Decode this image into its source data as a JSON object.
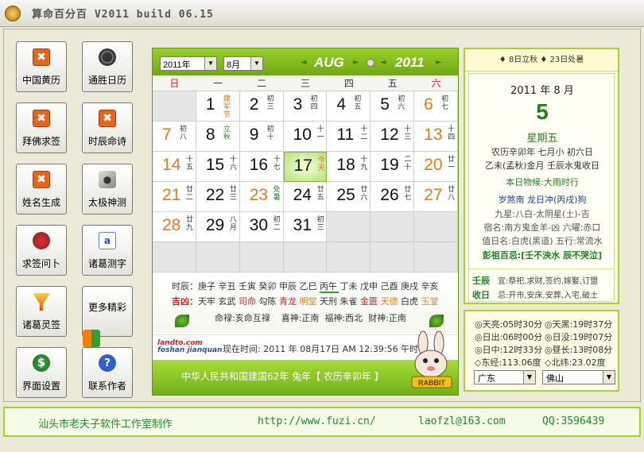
{
  "window": {
    "title": "算命百分百 V2011 build 06.15"
  },
  "buttons": [
    {
      "label": "中国黄历",
      "icon": "orange-x-icon"
    },
    {
      "label": "通胜日历",
      "icon": "film-reel-icon"
    },
    {
      "label": "拜佛求签",
      "icon": "orange-x-icon"
    },
    {
      "label": "时辰命诗",
      "icon": "orange-x-icon"
    },
    {
      "label": "姓名生成",
      "icon": "orange-x-icon"
    },
    {
      "label": "太极神测",
      "icon": "dice-icon"
    },
    {
      "label": "求签问卜",
      "icon": "fortune-stick-icon"
    },
    {
      "label": "诸葛测字",
      "icon": "character-note-icon"
    },
    {
      "label": "诸葛灵签",
      "icon": "funnel-icon"
    },
    {
      "label": "更多精彩",
      "icon": "blocks-icon"
    },
    {
      "label": "界面设置",
      "icon": "settings-icon"
    },
    {
      "label": "联系作者",
      "icon": "help-icon"
    }
  ],
  "calendar": {
    "year_select": "2011年",
    "month_select": "8月",
    "month_en": "AUG",
    "year_en": "2011",
    "weekdays": [
      "日",
      "一",
      "二",
      "三",
      "四",
      "五",
      "六"
    ],
    "days": [
      {
        "d": "",
        "l": ""
      },
      {
        "d": "1",
        "l": "建军节",
        "c": "fest"
      },
      {
        "d": "2",
        "l": "初三"
      },
      {
        "d": "3",
        "l": "初四"
      },
      {
        "d": "4",
        "l": "初五"
      },
      {
        "d": "5",
        "l": "初六"
      },
      {
        "d": "6",
        "l": "初七",
        "wk": true
      },
      {
        "d": "7",
        "l": "初八",
        "wk": true
      },
      {
        "d": "8",
        "l": "立秋",
        "c": "term"
      },
      {
        "d": "9",
        "l": "初十"
      },
      {
        "d": "10",
        "l": "十一"
      },
      {
        "d": "11",
        "l": "十二"
      },
      {
        "d": "12",
        "l": "十三"
      },
      {
        "d": "13",
        "l": "十四",
        "wk": true
      },
      {
        "d": "14",
        "l": "十五",
        "wk": true
      },
      {
        "d": "15",
        "l": "十六"
      },
      {
        "d": "16",
        "l": "十七"
      },
      {
        "d": "17",
        "l": "今天",
        "c": "fest",
        "today": true
      },
      {
        "d": "18",
        "l": "十九"
      },
      {
        "d": "19",
        "l": "二十"
      },
      {
        "d": "20",
        "l": "廿一",
        "wk": true
      },
      {
        "d": "21",
        "l": "廿二",
        "wk": true
      },
      {
        "d": "22",
        "l": "廿三"
      },
      {
        "d": "23",
        "l": "处暑",
        "c": "term",
        "wk": true
      },
      {
        "d": "24",
        "l": "廿五"
      },
      {
        "d": "25",
        "l": "廿六"
      },
      {
        "d": "26",
        "l": "廿七"
      },
      {
        "d": "27",
        "l": "廿八",
        "wk": true
      },
      {
        "d": "28",
        "l": "廿九",
        "wk": true
      },
      {
        "d": "29",
        "l": "八月"
      },
      {
        "d": "30",
        "l": "初二"
      },
      {
        "d": "31",
        "l": "初三"
      },
      {
        "d": "",
        "l": ""
      },
      {
        "d": "",
        "l": ""
      },
      {
        "d": "",
        "l": ""
      },
      {
        "d": "",
        "l": ""
      },
      {
        "d": "",
        "l": ""
      },
      {
        "d": "",
        "l": ""
      },
      {
        "d": "",
        "l": ""
      },
      {
        "d": "",
        "l": ""
      },
      {
        "d": "",
        "l": ""
      },
      {
        "d": "",
        "l": ""
      }
    ],
    "shichen": "时辰：庚子 辛丑 壬寅 癸卯 甲辰 乙巳 丙午 丁未 戊申 己酉 庚戌 辛亥",
    "jixiong_label": "吉凶：",
    "jixiong": "天牢 玄武 司命 勾陈 青龙 明堂 天刑 朱雀 金匮 天德 白虎 玉堂",
    "mingyue": "命禄:亥命互禄",
    "xishen": "喜神:正南",
    "fushen": "福神:西北",
    "caishen": "财神:正南",
    "brand_line1": "landto.com",
    "brand_line2": "foshan jianquan",
    "now_time": "现在时间: 2011 年 08月17日 AM 12:39:56 午时",
    "footer": "中华人民共和国建国62年   兔年【 农历辛卯年 】",
    "rabbit_text": "RABBIT"
  },
  "almanac": {
    "top": "♦ 8日立秋  ♦ 23日处暑",
    "yearmonth": "2011 年  8 月",
    "day": "5",
    "weekday": "星期五",
    "lunar1": "农历辛卯年 七月小 初六日",
    "lunar2": "乙未(孟秋)金月 壬辰水鬼收日",
    "element": "本日物候:大雨时行",
    "sha": "岁煞南  龙日冲(丙戌)狗",
    "star1": "九星:八白-太阴星(土)-吉",
    "star2": "宿名:南方鬼金羊-凶 六曜:赤口",
    "star3": "值日名:白虎(黑道) 五行:常流水",
    "pengzu": "彭祖百忌:[壬不泱水 辰不哭泣]",
    "yi_label": "壬辰",
    "yi": "宜:祭祀,求财,签约,嫁娶,订盟",
    "ji_label": "收日",
    "ji": "忌:开市,安床,安葬,入宅,破土"
  },
  "sun": {
    "l1a": "◎天亮:05时30分",
    "l1b": "◎天黑:19时37分",
    "l2a": "◎日出:06时00分",
    "l2b": "◎日没:19时07分",
    "l3a": "◎日中:12时33分",
    "l3b": "◎昼长:13时08分",
    "l4a": "◇东经:113.06度",
    "l4b": "◇北纬:23.02度",
    "province": "广东",
    "city": "佛山"
  },
  "status": {
    "studio": "汕头市老夫子软件工作室制作",
    "url": "http://www.fuzi.cn/",
    "email": "laofzl@163.com",
    "qq": "QQ:3596439"
  }
}
